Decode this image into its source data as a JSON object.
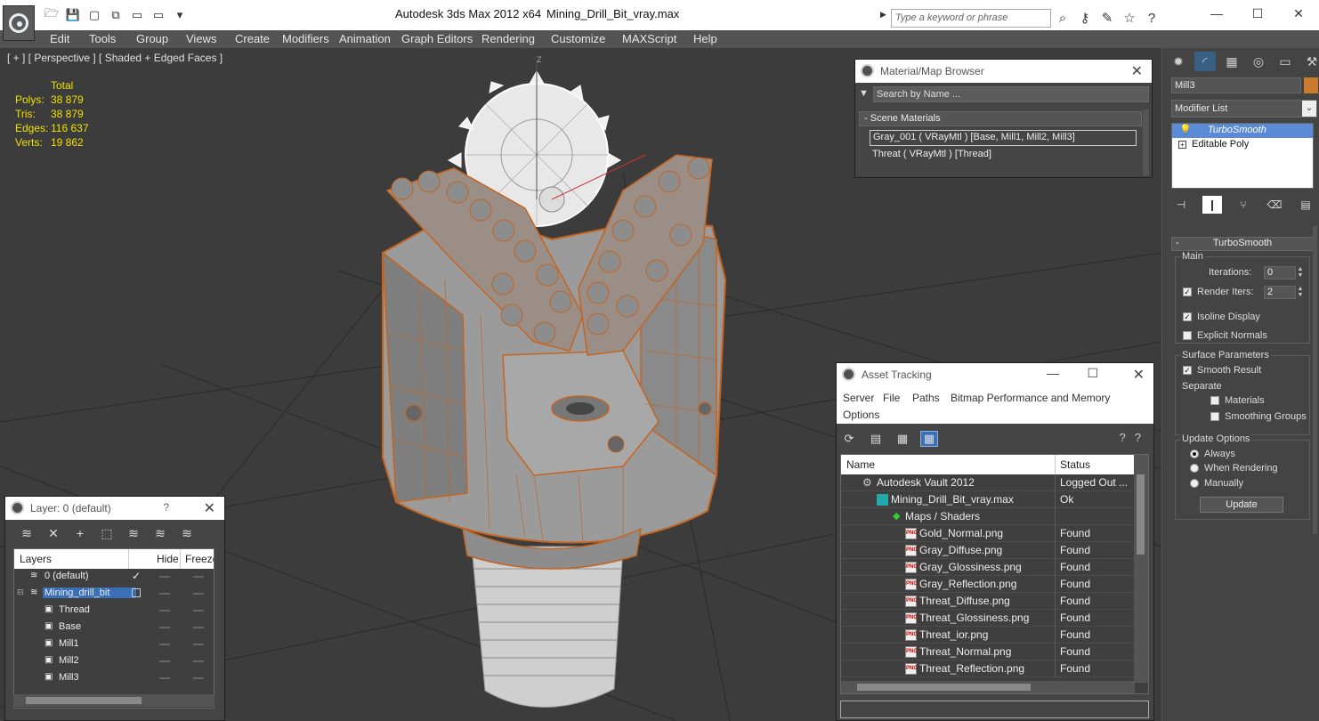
{
  "titlebar": {
    "app_title": "Autodesk 3ds Max  2012 x64",
    "file_name": "Mining_Drill_Bit_vray.max",
    "search_placeholder": "Type a keyword or phrase",
    "minimize": "—",
    "maximize": "☐",
    "close": "✕"
  },
  "menu": [
    "Edit",
    "Tools",
    "Group",
    "Views",
    "Create",
    "Modifiers",
    "Animation",
    "Graph Editors",
    "Rendering",
    "Customize",
    "MAXScript",
    "Help"
  ],
  "viewport": {
    "label": "[ + ] [ Perspective ] [ Shaded + Edged Faces ]",
    "stats": {
      "header": "Total",
      "rows": [
        {
          "key": "Polys:",
          "value": "38 879"
        },
        {
          "key": "Tris:",
          "value": "38 879"
        },
        {
          "key": "Edges:",
          "value": "116 637"
        },
        {
          "key": "Verts:",
          "value": "19 862"
        }
      ]
    },
    "axis_label": "Z"
  },
  "command_panel": {
    "object_name": "Mill3",
    "modifier_list": "Modifier List",
    "stack": [
      "TurboSmooth",
      "Editable Poly"
    ],
    "rollout_title": "TurboSmooth",
    "main_group": "Main",
    "iterations_label": "Iterations:",
    "iterations_value": "0",
    "render_iters_label": "Render Iters:",
    "render_iters_value": "2",
    "isoline_label": "Isoline Display",
    "explicit_label": "Explicit Normals",
    "surface_group": "Surface Parameters",
    "smooth_result_label": "Smooth Result",
    "separate_label": "Separate",
    "materials_label": "Materials",
    "smoothing_groups_label": "Smoothing Groups",
    "update_group": "Update Options",
    "always_label": "Always",
    "when_rendering_label": "When Rendering",
    "manually_label": "Manually",
    "update_button": "Update",
    "colors": {
      "object_color": "#c97a2c"
    }
  },
  "material_browser": {
    "title": "Material/Map Browser",
    "search_placeholder": "Search by Name ...",
    "section": "Scene Materials",
    "items": [
      "Gray_001  ( VRayMtl )  [Base, Mill1, Mill2, Mill3]",
      "Threat  ( VRayMtl )  [Thread]"
    ]
  },
  "asset_tracking": {
    "title": "Asset Tracking",
    "menu": [
      "Server",
      "File",
      "Paths",
      "Bitmap Performance and Memory",
      "Options"
    ],
    "col_name": "Name",
    "col_status": "Status",
    "rows": [
      {
        "name": "Autodesk Vault 2012",
        "status": "Logged Out ..."
      },
      {
        "name": "Mining_Drill_Bit_vray.max",
        "status": "Ok"
      },
      {
        "name": "Maps / Shaders",
        "status": ""
      },
      {
        "name": "Gold_Normal.png",
        "status": "Found"
      },
      {
        "name": "Gray_Diffuse.png",
        "status": "Found"
      },
      {
        "name": "Gray_Glossiness.png",
        "status": "Found"
      },
      {
        "name": "Gray_Reflection.png",
        "status": "Found"
      },
      {
        "name": "Threat_Diffuse.png",
        "status": "Found"
      },
      {
        "name": "Threat_Glossiness.png",
        "status": "Found"
      },
      {
        "name": "Threat_ior.png",
        "status": "Found"
      },
      {
        "name": "Threat_Normal.png",
        "status": "Found"
      },
      {
        "name": "Threat_Reflection.png",
        "status": "Found"
      }
    ]
  },
  "layer_window": {
    "title": "Layer: 0 (default)",
    "help": "?",
    "col_layers": "Layers",
    "col_hide": "Hide",
    "col_freeze": "Freeze",
    "rows": [
      {
        "name": "0 (default)"
      },
      {
        "name": "Mining_drill_bit"
      },
      {
        "name": "Thread"
      },
      {
        "name": "Base"
      },
      {
        "name": "Mill1"
      },
      {
        "name": "Mill2"
      },
      {
        "name": "Mill3"
      }
    ]
  }
}
